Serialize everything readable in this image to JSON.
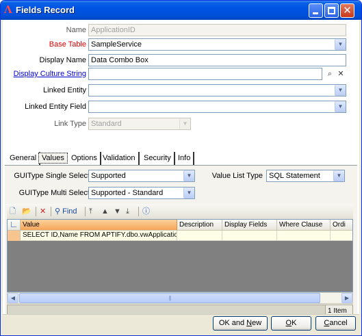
{
  "window": {
    "title": "Fields Record"
  },
  "form": {
    "name": {
      "label": "Name",
      "value": "ApplicationID"
    },
    "base_table": {
      "label": "Base Table",
      "value": "SampleService"
    },
    "display_name": {
      "label": "Display Name",
      "value": "Data Combo Box"
    },
    "display_culture_string": {
      "label": "Display Culture String",
      "value": ""
    },
    "linked_entity": {
      "label": "Linked Entity",
      "value": ""
    },
    "linked_entity_field": {
      "label": "Linked Entity Field",
      "value": ""
    },
    "link_type": {
      "label": "Link Type",
      "value": "Standard"
    }
  },
  "tabs": [
    {
      "label": "General"
    },
    {
      "label": "Values",
      "active": true
    },
    {
      "label": "Options"
    },
    {
      "label": "Validation"
    },
    {
      "label": "Security"
    },
    {
      "label": "Info"
    }
  ],
  "values_tab": {
    "gui_single": {
      "label": "GUIType Single Select",
      "value": "Supported"
    },
    "gui_multi": {
      "label": "GUIType Multi Select",
      "value": "Supported - Standard"
    },
    "value_list_type": {
      "label": "Value List Type",
      "value": "SQL Statement"
    },
    "toolbar": {
      "find_label": "Find"
    },
    "grid": {
      "columns": [
        "Value",
        "Description",
        "Display Fields",
        "Where Clause",
        "Ordi"
      ],
      "rows": [
        [
          "SELECT ID,Name FROM APTIFY.dbo.vwApplications",
          "",
          "",
          "",
          ""
        ]
      ]
    },
    "status": {
      "count": "1 Item"
    }
  },
  "buttons": {
    "ok_new": {
      "pre": "OK and ",
      "key": "N",
      "post": "ew"
    },
    "ok": {
      "key": "O",
      "post": "K"
    },
    "cancel": {
      "key": "C",
      "post": "ancel"
    }
  },
  "icons": {
    "accent": "#0054e3",
    "title_icon": "app-logo-icon",
    "culture_lookup": "binoculars-icon",
    "culture_clear": "clear-x-icon"
  }
}
